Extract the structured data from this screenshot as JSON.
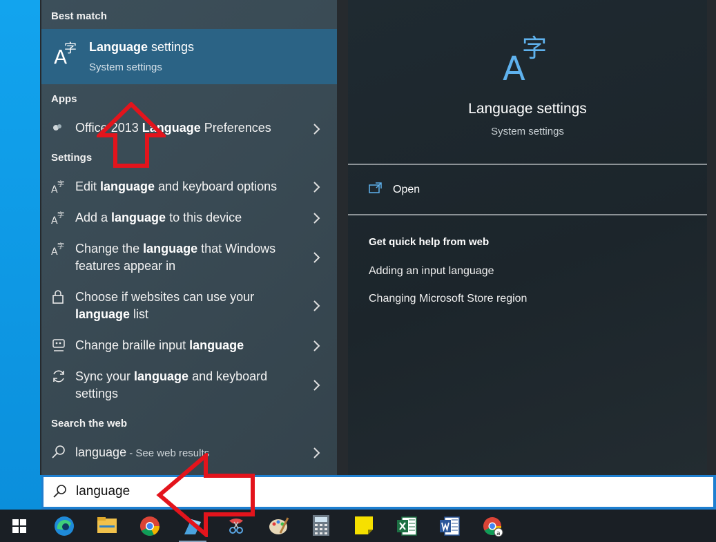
{
  "best_match": {
    "section_label": "Best match",
    "title_bold": "Language",
    "title_rest": " settings",
    "subtitle": "System settings"
  },
  "apps": {
    "section_label": "Apps",
    "items": [
      {
        "pre": "Office 2013 ",
        "bold": "Language",
        "post": " Preferences"
      }
    ]
  },
  "settings": {
    "section_label": "Settings",
    "items": [
      {
        "pre": "Edit ",
        "bold": "language",
        "post": " and keyboard options"
      },
      {
        "pre": "Add a ",
        "bold": "language",
        "post": " to this device"
      },
      {
        "pre": "Change the ",
        "bold": "language",
        "post": " that Windows features appear in"
      },
      {
        "pre": "Choose if websites can use your ",
        "bold": "language",
        "post": " list"
      },
      {
        "pre": "Change braille input ",
        "bold": "language",
        "post": ""
      },
      {
        "pre": "Sync your ",
        "bold": "language",
        "post": " and keyboard settings"
      }
    ]
  },
  "web": {
    "section_label": "Search the web",
    "query": "language",
    "suffix": " - See web results"
  },
  "preview": {
    "title": "Language settings",
    "subtitle": "System settings",
    "open_label": "Open",
    "help_title": "Get quick help from web",
    "help_links": [
      "Adding an input language",
      "Changing Microsoft Store region"
    ]
  },
  "search": {
    "value": "language"
  },
  "taskbar": {
    "items": [
      "start-icon",
      "edge-icon",
      "file-explorer-icon",
      "chrome-icon",
      "app-icon",
      "snipping-tool-icon",
      "paint-icon",
      "calculator-icon",
      "sticky-notes-icon",
      "excel-icon",
      "word-icon",
      "chrome-beta-icon"
    ]
  },
  "colors": {
    "accent": "#2b6385",
    "annotation_arrow": "#e3141c",
    "search_border": "#1e7fd0"
  }
}
